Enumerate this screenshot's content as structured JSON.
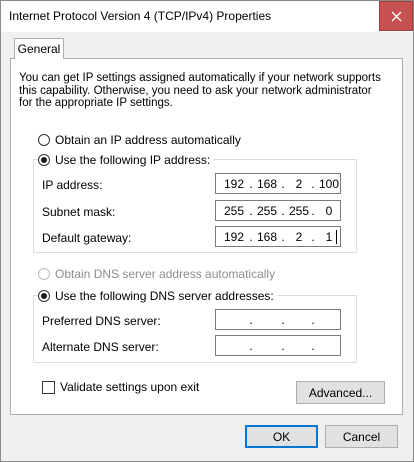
{
  "window": {
    "title": "Internet Protocol Version 4 (TCP/IPv4) Properties",
    "close_glyph": "close-icon"
  },
  "tabs": [
    {
      "label": "General",
      "selected": true
    }
  ],
  "description": "You can get IP settings assigned automatically if your network supports this capability. Otherwise, you need to ask your network administrator for the appropriate IP settings.",
  "ip_section": {
    "auto_label": "Obtain an IP address automatically",
    "auto_selected": false,
    "manual_label": "Use the following IP address:",
    "manual_selected": true,
    "fields": [
      {
        "label": "IP address:",
        "octets": [
          "192",
          "168",
          "2",
          "100"
        ]
      },
      {
        "label": "Subnet mask:",
        "octets": [
          "255",
          "255",
          "255",
          "0"
        ]
      },
      {
        "label": "Default gateway:",
        "octets": [
          "192",
          "168",
          "2",
          "1"
        ]
      }
    ]
  },
  "dns_section": {
    "auto_label": "Obtain DNS server address automatically",
    "auto_selected": false,
    "auto_disabled": true,
    "manual_label": "Use the following DNS server addresses:",
    "manual_selected": true,
    "fields": [
      {
        "label": "Preferred DNS server:",
        "octets": [
          "",
          "",
          "",
          ""
        ]
      },
      {
        "label": "Alternate DNS server:",
        "octets": [
          "",
          "",
          "",
          ""
        ]
      }
    ]
  },
  "validate": {
    "label": "Validate settings upon exit",
    "checked": false
  },
  "buttons": {
    "advanced": "Advanced...",
    "ok": "OK",
    "cancel": "Cancel"
  },
  "colors": {
    "close_bg": "#c75050",
    "default_button_border": "#0078d7"
  }
}
